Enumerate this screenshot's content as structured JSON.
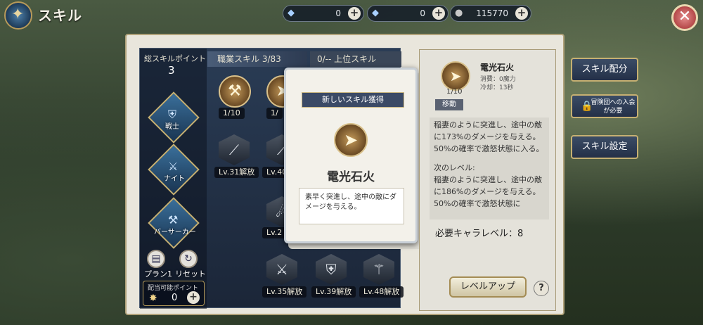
{
  "header": {
    "title": "スキル",
    "currencies": [
      {
        "icon": "crystal-icon",
        "value": "0"
      },
      {
        "icon": "locked-crystal-icon",
        "value": "0"
      },
      {
        "icon": "coin-icon",
        "value": "115770"
      }
    ]
  },
  "left": {
    "total_label": "総スキルポイント",
    "total_value": "3",
    "classes": [
      "戦士",
      "ナイト",
      "バーサーカー"
    ],
    "plan_label": "プラン1",
    "reset_label": "リセット",
    "points_label": "配当可能ポイント",
    "points_value": "0"
  },
  "tabs": {
    "job": "職業スキル 3/83",
    "upper": "0/-- 上位スキル"
  },
  "skills": {
    "node1_level": "1/10",
    "node2_level": "1/",
    "hex1_caption": "Lv.31解放",
    "hex2_caption": "Lv.40",
    "hex3_caption": "Lv.2",
    "bottom": [
      "Lv.35解放",
      "Lv.39解放",
      "Lv.48解放"
    ]
  },
  "popup": {
    "header": "新しいスキル獲得",
    "name": "電光石火",
    "desc": "素早く突進し、途中の敵にダメージを与える。"
  },
  "detail": {
    "name": "電光石火",
    "level": "1/10",
    "cost": "消費：0魔力",
    "cooldown": "冷却：13秒",
    "tag": "移動",
    "desc_current": "稲妻のように突進し、途中の敵に173%のダメージを与える。50%の確率で激怒状態に入る。",
    "next_label": "次のレベル:",
    "desc_next": "稲妻のように突進し、途中の敵に186%のダメージを与える。50%の確率で激怒状態に",
    "required": "必要キャラレベル：8",
    "levelup": "レベルアップ",
    "help": "?"
  },
  "side": {
    "allocate": "スキル配分",
    "guild": "冒険団への入会が必要",
    "settings": "スキル設定"
  }
}
